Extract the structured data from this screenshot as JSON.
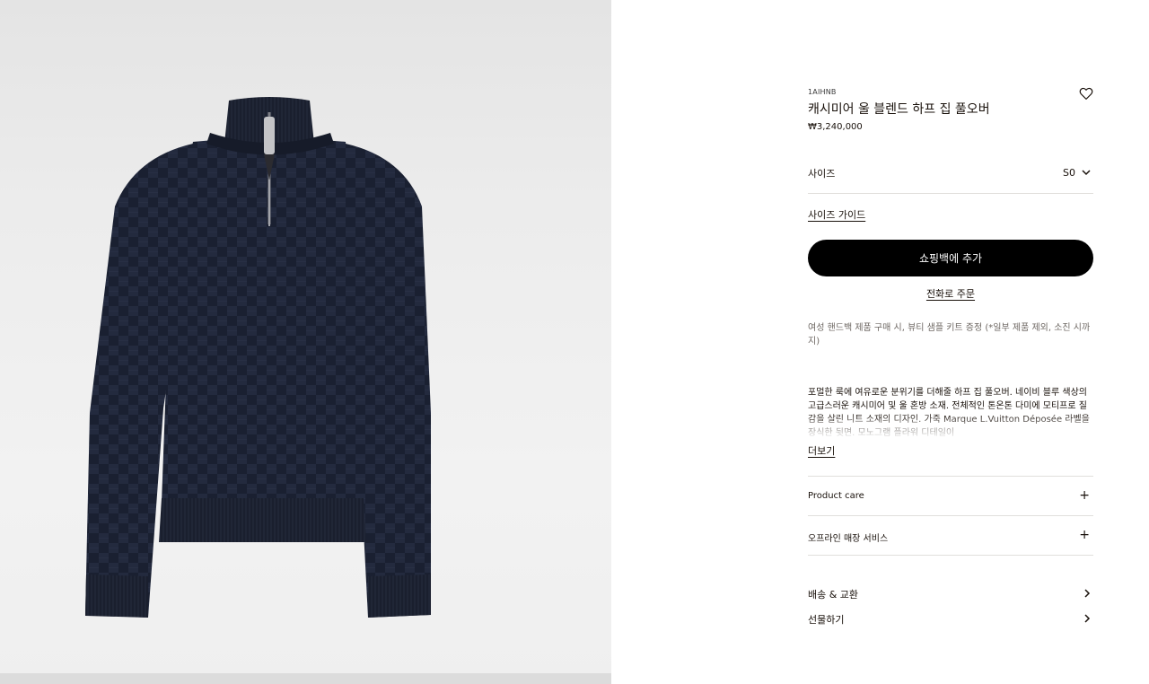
{
  "product": {
    "sku": "1AIHNB",
    "title": "캐시미어 울 블렌드 하프 집 풀오버",
    "price": "₩3,240,000",
    "wishlist_icon": "heart-icon",
    "image_alt_colors": {
      "sweater": "#1c2233",
      "zipper": "#c9c9c9"
    }
  },
  "size": {
    "label": "사이즈",
    "value": "S0"
  },
  "size_guide_label": "사이즈 가이드",
  "add_to_bag_label": "쇼핑백에 추가",
  "phone_order_label": "전화로 주문",
  "promo_text": "여성 핸드백 제품 구매 시, 뷰티 샘플 키트 증정 (*일부 제품 제외, 소진 시까지)",
  "description": "포멀한 룩에 여유로운 분위기를 더해줄 하프 집 풀오버. 네이비 블루 색상의 고급스러운 캐시미어 및 울 혼방 소재. 전체적인 톤온톤 다미에 모티프로 질감을 살린 니트 소재의 디자인. 가죽 Marque L.Vuitton Déposée 라벨을 장식한 뒷면. 모노그램 플라워 디테일이",
  "read_more_label": "더보기",
  "accordions": [
    {
      "label": "Product care",
      "icon": "+"
    },
    {
      "label": "오프라인 매장 서비스",
      "icon": "+"
    }
  ],
  "links": [
    {
      "label": "배송 & 교환"
    },
    {
      "label": "선물하기"
    }
  ],
  "colors": {
    "button_bg": "#000000",
    "button_text": "#ffffff",
    "divider": "#e1dfdc",
    "image_bg": "#ececec"
  }
}
